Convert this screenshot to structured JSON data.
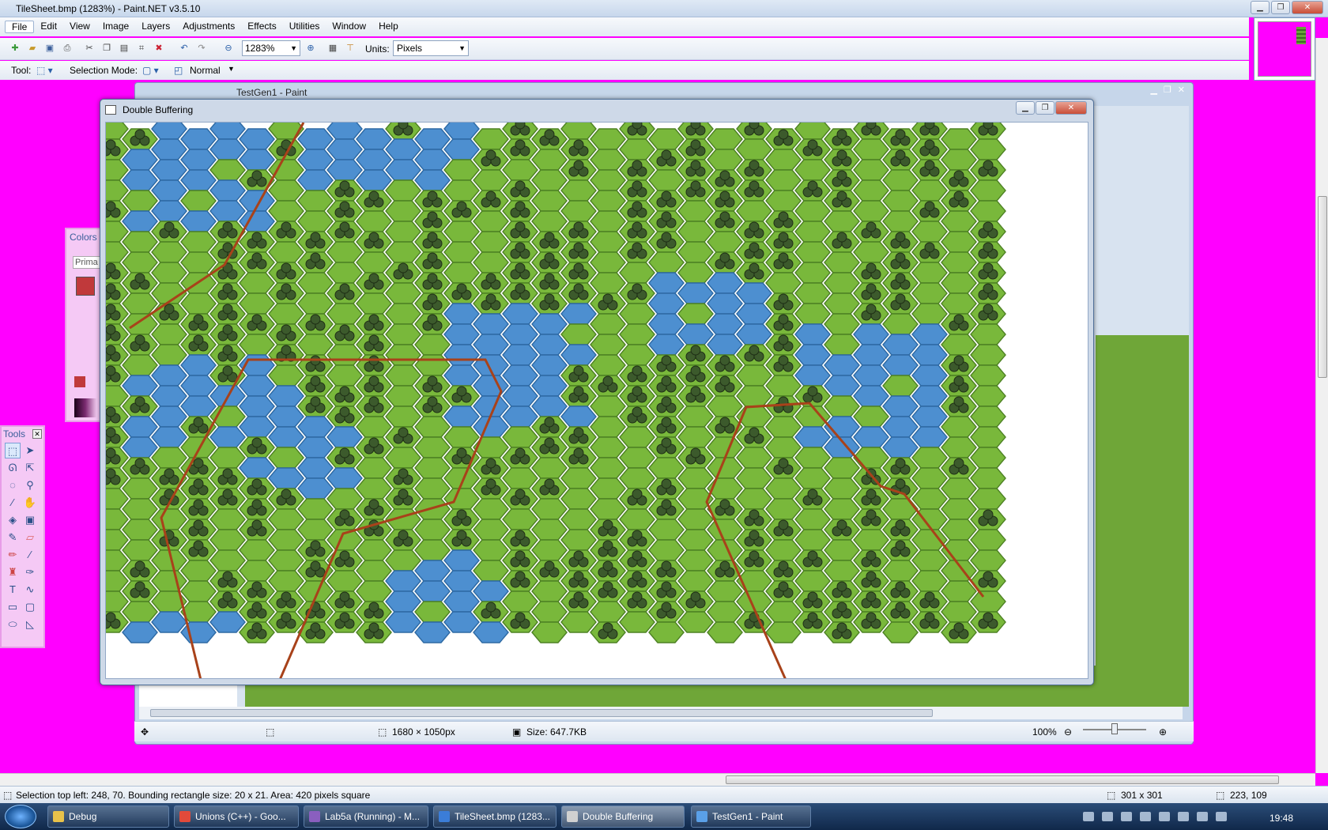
{
  "app": {
    "title": "TileSheet.bmp (1283%) - Paint.NET v3.5.10",
    "menu": [
      "File",
      "Edit",
      "View",
      "Image",
      "Layers",
      "Adjustments",
      "Effects",
      "Utilities",
      "Window",
      "Help"
    ],
    "zoom": "1283%",
    "units_label": "Units:",
    "units_value": "Pixels",
    "tool_label": "Tool:",
    "selection_mode_label": "Selection Mode:",
    "blend_mode": "Normal",
    "status": {
      "selection_info": "Selection top left: 248, 70. Bounding rectangle size: 20 x 21. Area: 420 pixels square",
      "size": "301 x 301",
      "cursor": "223, 109"
    },
    "colors_title": "Colors",
    "colors_tab": "Prima",
    "tools_title": "Tools"
  },
  "paint_window": {
    "title": "TestGen1 - Paint",
    "dimensions": "1680 × 1050px",
    "size": "Size: 647.7KB",
    "zoom": "100%"
  },
  "db_window": {
    "title": "Double Buffering",
    "map": {
      "cols": 31,
      "rows": 25,
      "water_color": "#4d8fd0",
      "grass_color": "#79b83b",
      "tree_color": "#3c5a2c",
      "road_color": "#a8421a"
    }
  },
  "taskbar": {
    "items": [
      {
        "label": "Debug",
        "color": "#e8c24a"
      },
      {
        "label": "Unions (C++) - Goo...",
        "color": "#e24a3a"
      },
      {
        "label": "Lab5a (Running) - M...",
        "color": "#8a5fbf"
      },
      {
        "label": "TileSheet.bmp (1283...",
        "color": "#3b7dd8"
      },
      {
        "label": "Double Buffering",
        "color": "#d0d0d0"
      },
      {
        "label": "TestGen1 - Paint",
        "color": "#5aa0e8"
      }
    ],
    "clock": "19:48"
  }
}
